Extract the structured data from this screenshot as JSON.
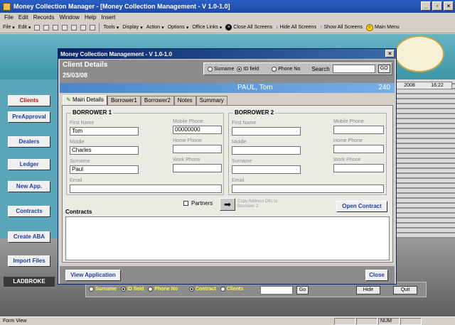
{
  "window": {
    "title": "Money Collection Manager - [Money Collection Management - V 1.0-1.0]",
    "buttons": {
      "minimize": "_",
      "restore": "▫",
      "close": "×"
    }
  },
  "menubar": [
    "File",
    "Edit",
    "Records",
    "Window",
    "Help",
    "Insert"
  ],
  "toolbar": {
    "file": "File",
    "edit": "Edit",
    "tools": "Tools",
    "display": "Display",
    "action": "Action",
    "options": "Options",
    "office_links": "Office Links",
    "close_all": "Close All Screens",
    "hide_all": "Hide All Screens",
    "show_all": "Show All Screens",
    "main_menu": "Main Menu"
  },
  "sidebar": [
    {
      "label": "Clients",
      "style": "red"
    },
    {
      "label": "PreApproval",
      "style": "normal"
    },
    {
      "label": "Dealers",
      "style": "normal"
    },
    {
      "label": "Ledger",
      "style": "normal"
    },
    {
      "label": "New App.",
      "style": "normal"
    },
    {
      "label": "Contracts",
      "style": "normal"
    },
    {
      "label": "Create ABA",
      "style": "normal"
    },
    {
      "label": "Import Files",
      "style": "normal"
    },
    {
      "label": "LADBROKE",
      "style": "dark"
    }
  ],
  "background": {
    "date": "2008",
    "time": "16:22",
    "radios": [
      "Surname",
      "ID field",
      "Phone No",
      "Contract",
      "Clients"
    ],
    "go": "Go",
    "hide": "Hide",
    "quit": "Quit"
  },
  "modal": {
    "title": "Money Collection Management - V 1.0-1.0",
    "close": "×",
    "header": {
      "title": "Client Details",
      "date": "25/03/08"
    },
    "search": {
      "options": [
        "Surname",
        "ID field",
        "Phone No"
      ],
      "selected": "ID field",
      "label": "Search",
      "value": "",
      "go": "GO"
    },
    "client_name": "PAUL, Tom",
    "client_id": "240",
    "tabs": [
      "Main Details",
      "Borrower1",
      "Borrower2",
      "Notes",
      "Summary"
    ],
    "active_tab": "Main Details",
    "borrower1": {
      "title": "BORROWER 1",
      "first_name_label": "First Name",
      "first_name": "Tom",
      "middle_label": "Middle",
      "middle": "Charles",
      "surname_label": "Surname",
      "surname": "Paul",
      "email_label": "Email",
      "email": "",
      "mobile_label": "Mobile Phone",
      "mobile": "00000000",
      "home_label": "Home Phone",
      "home": "",
      "work_label": "Work Phone",
      "work": ""
    },
    "borrower2": {
      "title": "BORROWER 2",
      "first_name_label": "First Name",
      "first_name": "",
      "middle_label": "Middle",
      "middle": "",
      "surname_label": "Surname",
      "surname": "",
      "email_label": "Email",
      "email": "",
      "mobile_label": "Mobile Phone",
      "mobile": "",
      "home_label": "Home Phone",
      "home": "",
      "work_label": "Work Phone",
      "work": ""
    },
    "partners_label": "Partners",
    "copy_address_label": "Copy Address Dtls to Borrower 2",
    "open_contract": "Open Contract",
    "contracts_label": "Contracts",
    "view_application": "View Application",
    "close_button": "Close"
  },
  "statusbar": {
    "text": "Form View",
    "num": "NUM"
  }
}
